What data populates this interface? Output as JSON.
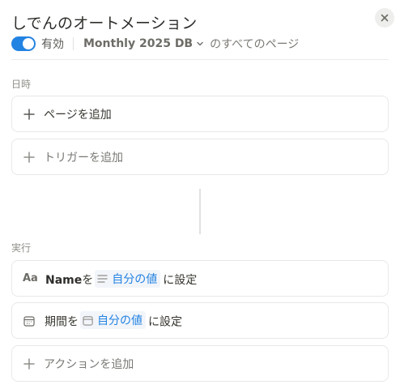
{
  "header": {
    "title": "しでんのオートメーション",
    "toggle_label": "有効",
    "database_name": "Monthly 2025 DB",
    "database_suffix": "のすべてのページ"
  },
  "trigger_section": {
    "label": "日時",
    "items": [
      {
        "label": "ページを追加",
        "icon": "plus-icon"
      },
      {
        "label": "トリガーを追加",
        "icon": "plus-icon"
      }
    ]
  },
  "action_section": {
    "label": "実行",
    "actions": [
      {
        "icon_text": "Aa",
        "property": "Name",
        "particle": "を",
        "value_icon": "text-lines-icon",
        "value": "自分の値",
        "suffix": "に設定"
      },
      {
        "icon": "calendar-icon",
        "property": "期間",
        "particle": "を",
        "value_icon": "calendar-icon",
        "value": "自分の値",
        "suffix": "に設定"
      }
    ],
    "add_label": "アクションを追加"
  },
  "colors": {
    "accent": "#2383e2",
    "text": "#37352f",
    "muted": "#8f8d88",
    "border": "#e9e8e6"
  }
}
